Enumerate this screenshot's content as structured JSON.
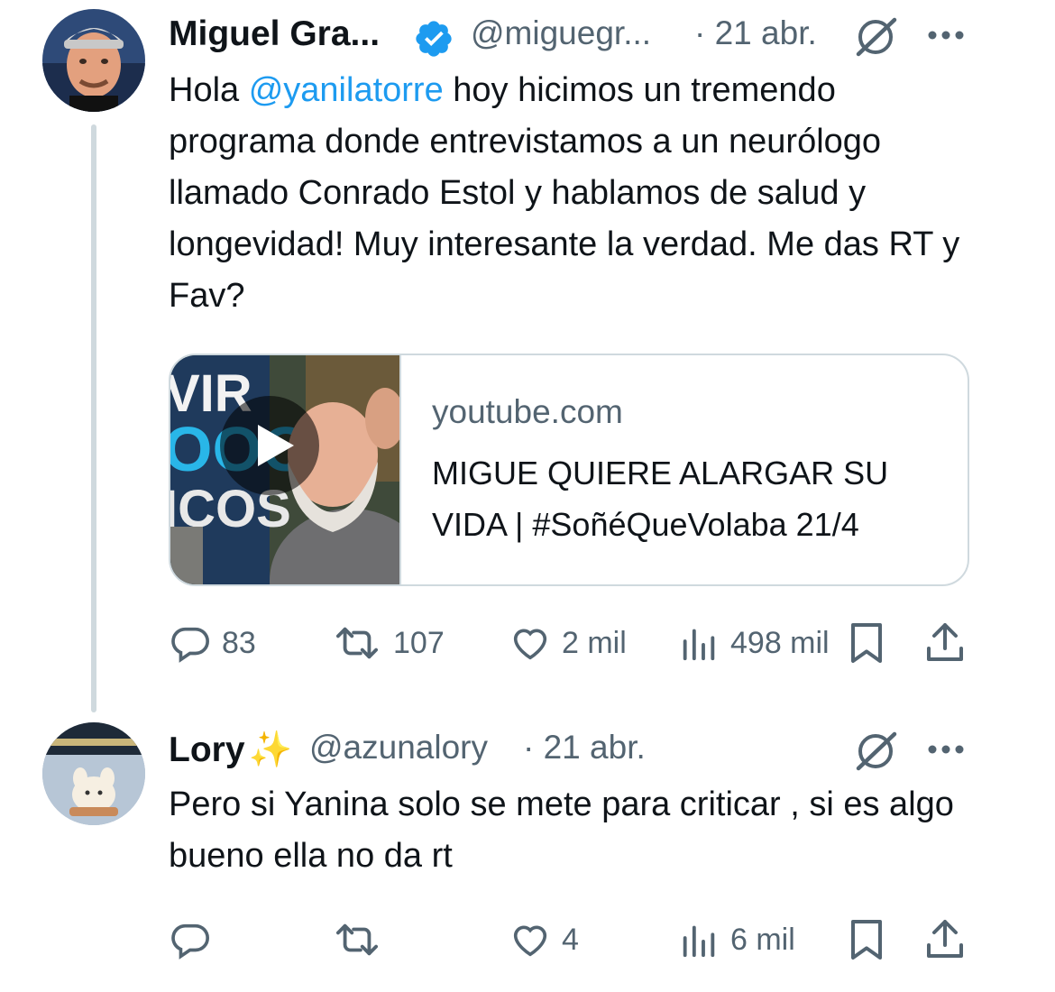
{
  "tweet1": {
    "author_name": "Miguel Gra...",
    "handle": "@miguegr...",
    "time": "· 21 abr.",
    "verified": true,
    "text_before_mention": "Hola ",
    "mention": "@yanilatorre",
    "text_after_mention": " hoy hicimos un tremendo programa donde entrevistamos a un neurólogo llamado Conrado Estol y hablamos de salud y longevidad! Muy interesante la verdad. Me das RT y Fav?",
    "card": {
      "domain": "youtube.com",
      "title": "MIGUE QUIERE ALARGAR SU VIDA | #SoñéQueVolaba 21/4",
      "thumbnail_text": "VIR OOO ICOS"
    },
    "actions": {
      "replies": "83",
      "retweets": "107",
      "likes": "2 mil",
      "views": "498 mil"
    }
  },
  "tweet2": {
    "author_name": "Lory",
    "name_emoji": "✨",
    "handle": "@azunalory",
    "time": "· 21 abr.",
    "text": "Pero si Yanina solo se mete para criticar , si es algo bueno ella no da rt",
    "actions": {
      "replies": "",
      "retweets": "",
      "likes": "4",
      "views": "6 mil"
    }
  },
  "colors": {
    "accent": "#1d9bf0",
    "secondary_text": "#536471",
    "border": "#cfd9de",
    "verified_badge": "#1d9bf0"
  },
  "icons": [
    "grok-icon",
    "more-icon",
    "reply-icon",
    "retweet-icon",
    "like-icon",
    "views-icon",
    "bookmark-icon",
    "share-icon",
    "verified-badge-icon",
    "play-icon"
  ]
}
